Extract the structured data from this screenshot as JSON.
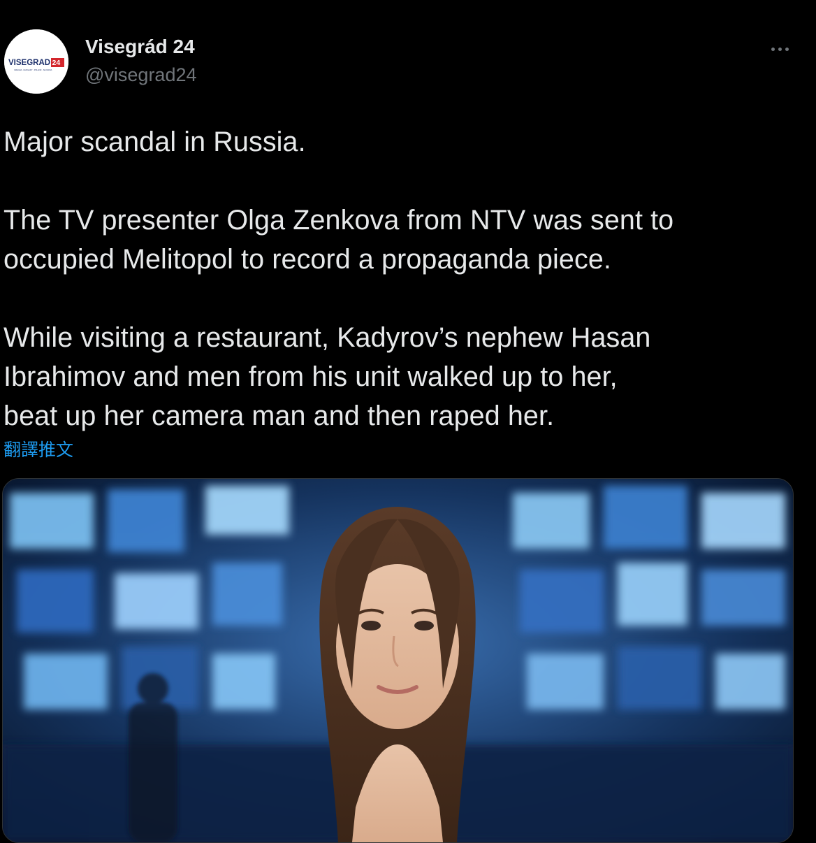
{
  "author": {
    "display_name": "Visegrád 24",
    "handle": "@visegrad24",
    "avatar": {
      "logo_text_main": "VISEGRAD",
      "logo_text_number": "24",
      "logo_subtext": "CZECHIA · HUNGARY · POLAND · SLOVAKIA",
      "icon": "visegrad24-logo"
    }
  },
  "more_menu": {
    "icon": "more-horizontal-icon"
  },
  "tweet": {
    "paragraphs": [
      [
        "Major scandal in Russia."
      ],
      [
        "The TV presenter Olga Zenkova from NTV was sent to",
        "occupied Melitopol to record a propaganda piece."
      ],
      [
        "While visiting a restaurant, Kadyrov’s nephew Hasan",
        "Ibrahimov and men from his unit walked up to her,",
        "beat up her camera man and then raped her."
      ]
    ],
    "translate_label": "翻譯推文"
  },
  "media": {
    "type": "photo",
    "icon": "tweet-photo"
  },
  "colors": {
    "background": "#000000",
    "text_primary": "#e7e9ea",
    "text_secondary": "#71767b",
    "link": "#1d9bf0",
    "logo_navy": "#1c2f6b",
    "logo_red": "#d3262c"
  }
}
